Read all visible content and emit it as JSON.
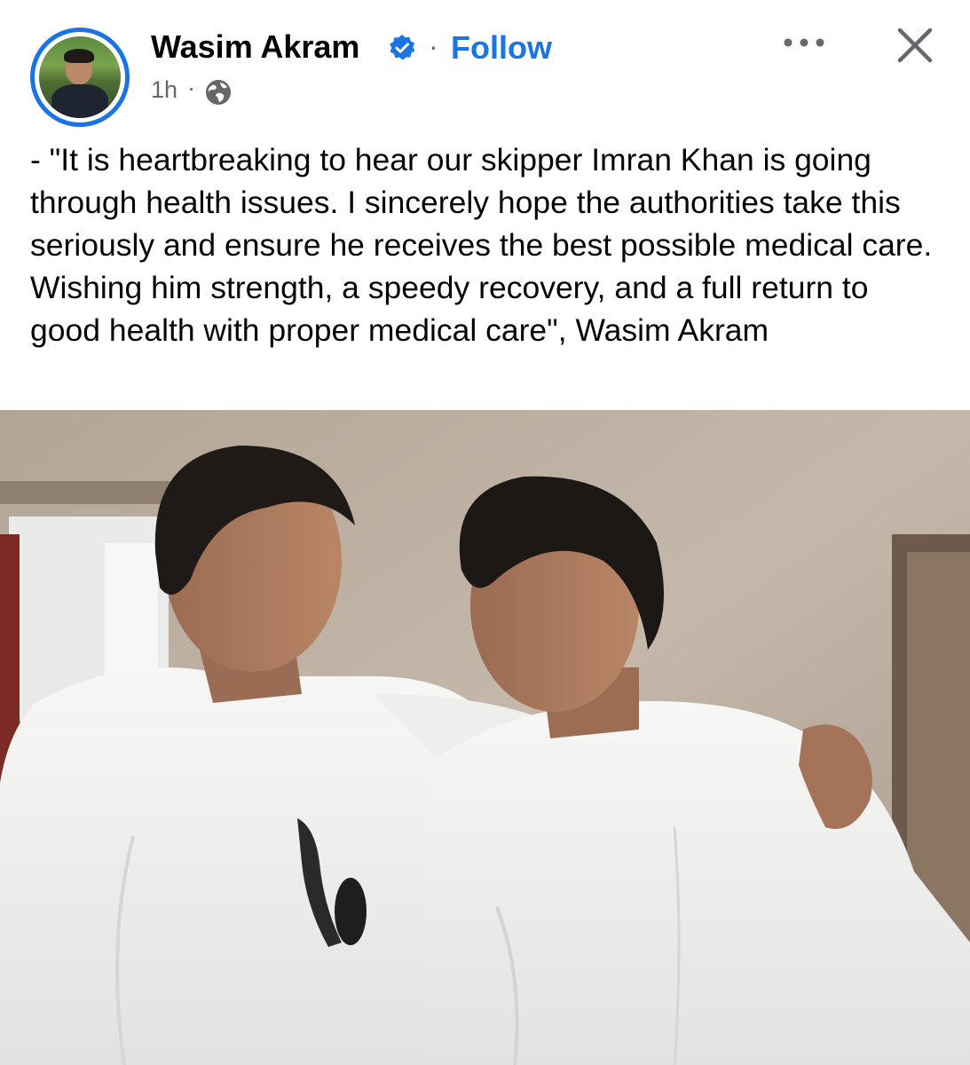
{
  "post": {
    "author": {
      "name": "Wasim Akram",
      "verified": true,
      "avatar_icon": "profile-photo",
      "ring_color": "#1b74e4"
    },
    "follow_label": "Follow",
    "separator": "·",
    "time": "1h",
    "privacy_icon": "globe-icon",
    "more_icon": "more-options-icon",
    "close_icon": "close-icon",
    "accent_color": "#1b74e4",
    "text": "- \"It is heartbreaking to hear our skipper Imran Khan is going through health issues. I sincerely hope the authorities take this seriously and ensure he receives the best possible medical care. Wishing him strength, a speedy recovery, and a full return to good health with proper medical care\", Wasim Akram"
  }
}
